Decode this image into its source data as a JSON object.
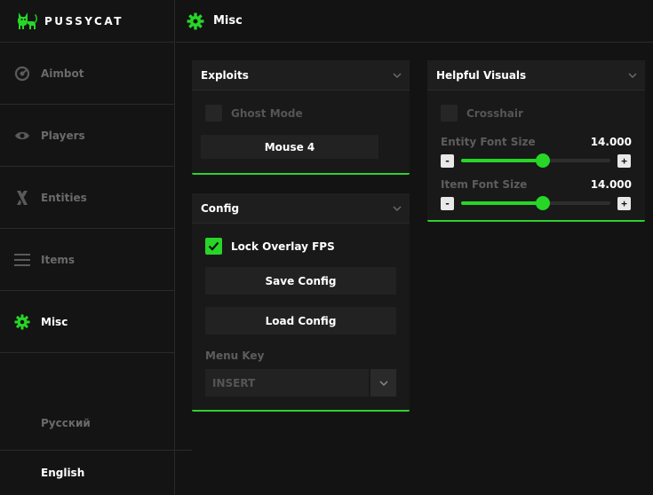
{
  "brand": {
    "name": "PUSSYCAT"
  },
  "sidebar": {
    "items": [
      {
        "label": "Aimbot",
        "icon": "radar-icon"
      },
      {
        "label": "Players",
        "icon": "eye-icon"
      },
      {
        "label": "Entities",
        "icon": "entities-icon"
      },
      {
        "label": "Items",
        "icon": "menu-lines-icon"
      },
      {
        "label": "Misc",
        "icon": "gear-icon",
        "active": true
      }
    ],
    "languages": [
      "Русский",
      "English"
    ]
  },
  "header": {
    "title": "Misc"
  },
  "exploits": {
    "title": "Exploits",
    "ghost_mode": {
      "label": "Ghost Mode",
      "checked": false
    },
    "key_button": "Mouse 4"
  },
  "config": {
    "title": "Config",
    "lock_fps": {
      "label": "Lock Overlay FPS",
      "checked": true
    },
    "save_label": "Save Config",
    "load_label": "Load Config",
    "menu_key_label": "Menu Key",
    "menu_key_value": "INSERT"
  },
  "visuals": {
    "title": "Helpful Visuals",
    "crosshair": {
      "label": "Crosshair",
      "checked": false
    },
    "entity_font": {
      "label": "Entity Font Size",
      "value": "14.000",
      "fraction": 0.55
    },
    "item_font": {
      "label": "Item Font Size",
      "value": "14.000",
      "fraction": 0.55
    },
    "minus": "-",
    "plus": "+"
  },
  "colors": {
    "accent": "#27d627",
    "background": "#131313",
    "panel": "#191919"
  }
}
